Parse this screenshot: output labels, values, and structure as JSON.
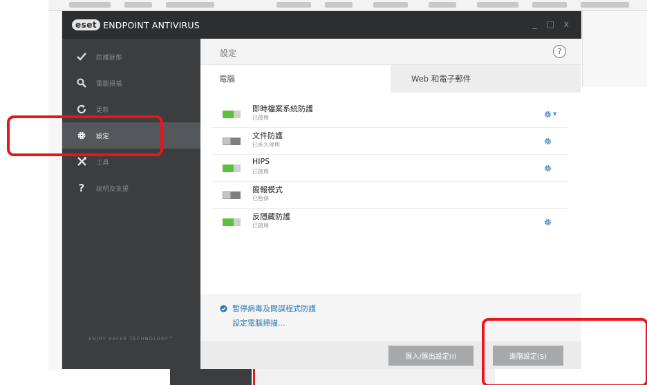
{
  "app": {
    "brand": "eset",
    "product": "ENDPOINT ANTIVIRUS",
    "controls": {
      "minimize": "_",
      "maximize": "□",
      "close": "x"
    }
  },
  "sidebar": {
    "items": [
      {
        "label": "防護狀態",
        "icon": "check-icon",
        "active": false
      },
      {
        "label": "電腦掃描",
        "icon": "search-icon",
        "active": false
      },
      {
        "label": "更新",
        "icon": "refresh-icon",
        "active": false
      },
      {
        "label": "設定",
        "icon": "gear-icon",
        "active": true
      },
      {
        "label": "工具",
        "icon": "tools-icon",
        "active": false
      },
      {
        "label": "說明及支援",
        "icon": "question-icon",
        "active": false
      }
    ],
    "tagline": "ENJOY SAFER TECHNOLOGY™"
  },
  "main": {
    "title": "設定",
    "help": "?",
    "tabs": [
      {
        "label": "電腦",
        "active": true
      },
      {
        "label": "Web 和電子郵件",
        "active": false
      }
    ],
    "features": [
      {
        "name": "即時檔案系統防護",
        "status": "已啟用",
        "enabled": true,
        "gear": true,
        "dropdown": true
      },
      {
        "name": "文件防護",
        "status": "已永久停用",
        "enabled": false,
        "gear": true,
        "dropdown": false
      },
      {
        "name": "HIPS",
        "status": "已啟用",
        "enabled": true,
        "gear": true,
        "dropdown": false
      },
      {
        "name": "簡報模式",
        "status": "已暫停",
        "enabled": false,
        "gear": false,
        "dropdown": false
      },
      {
        "name": "反隱藏防護",
        "status": "已啟用",
        "enabled": true,
        "gear": true,
        "dropdown": false
      }
    ],
    "footer": {
      "pause_link": "暫停病毒及間諜程式防護",
      "scan_link": "設定電腦掃描..."
    },
    "buttons": {
      "import_export": "匯入/匯出設定(I)",
      "advanced": "進階設定(S)"
    }
  },
  "colors": {
    "accent_blue": "#2a78b8",
    "toggle_on": "#5cc13a",
    "sidebar_bg": "#3b3d3f",
    "annotation_red": "#e8161c"
  }
}
